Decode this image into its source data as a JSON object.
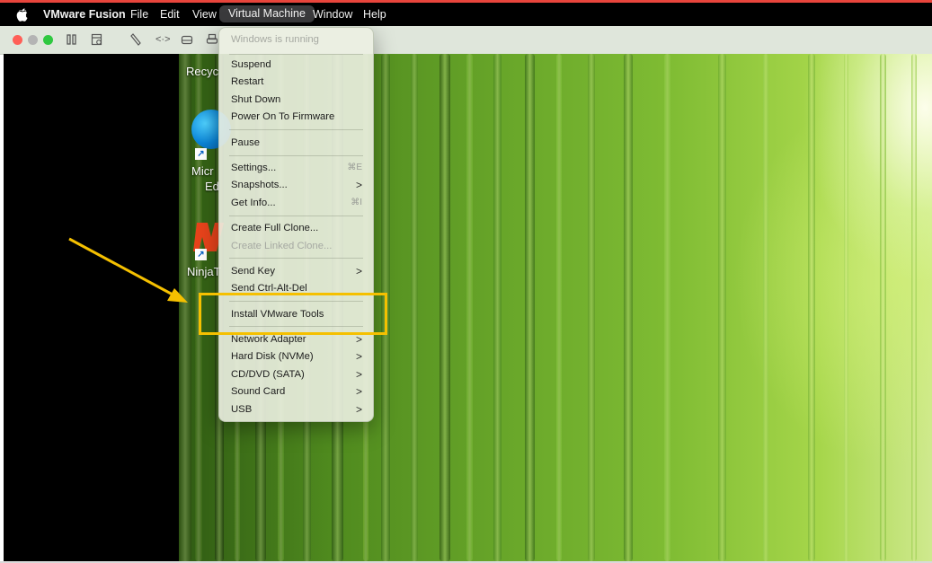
{
  "menubar": {
    "apple_icon": "apple-icon",
    "app_name": "VMware Fusion",
    "items": [
      {
        "label": "File"
      },
      {
        "label": "Edit"
      },
      {
        "label": "View"
      },
      {
        "label": "Virtual Machine"
      },
      {
        "label": "Window"
      },
      {
        "label": "Help"
      }
    ],
    "active_item": "Virtual Machine"
  },
  "toolbar": {
    "traffic_lights": [
      "#ff5f57",
      "#b4b4b4",
      "#b4b4b4"
    ],
    "icons": [
      "pause-icon",
      "snapshot-icon",
      "wrench-icon",
      "code-icon",
      "drive-icon",
      "printer-icon"
    ]
  },
  "desktop": {
    "icons": [
      {
        "label": "Recyc",
        "icon": "recycle-bin-icon"
      },
      {
        "label": "Micr",
        "label2": "Ed",
        "icon": "edge-icon"
      },
      {
        "label": "NinjaT",
        "icon": "ninja-icon"
      }
    ]
  },
  "vm_menu": {
    "header": "Windows is running",
    "items": [
      {
        "label": "Suspend"
      },
      {
        "label": "Restart"
      },
      {
        "label": "Shut Down"
      },
      {
        "label": "Power On To Firmware"
      },
      {
        "label": "Pause"
      },
      {
        "label": "Settings...",
        "shortcut": "⌘E"
      },
      {
        "label": "Snapshots...",
        "submenu": true
      },
      {
        "label": "Get Info...",
        "shortcut": "⌘I"
      },
      {
        "label": "Create Full Clone..."
      },
      {
        "label": "Create Linked Clone...",
        "disabled": true
      },
      {
        "label": "Send Key",
        "submenu": true
      },
      {
        "label": "Send Ctrl-Alt-Del"
      },
      {
        "label": "Install VMware Tools",
        "highlighted": true
      },
      {
        "label": "Network Adapter",
        "submenu": true
      },
      {
        "label": "Hard Disk (NVMe)",
        "submenu": true
      },
      {
        "label": "CD/DVD (SATA)",
        "submenu": true
      },
      {
        "label": "Sound Card",
        "submenu": true
      },
      {
        "label": "USB",
        "submenu": true
      }
    ],
    "arrow_glyph": ">"
  },
  "annotation": {
    "color": "#f5c000",
    "target": "Install VMware Tools"
  },
  "colors": {
    "menubar_bg": "#000000",
    "toolbar_bg": "#dfe6db",
    "accent_red": "#e8453c",
    "menu_bg": "#ecf0e2"
  }
}
